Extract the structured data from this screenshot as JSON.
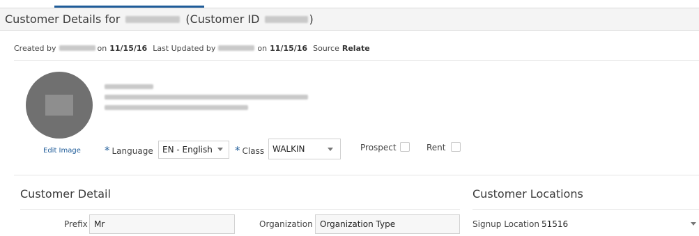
{
  "header": {
    "title_prefix": "Customer Details for",
    "title_customer_id_label": "(Customer ID",
    "title_close_paren": ")"
  },
  "meta": {
    "created_by_label": "Created by",
    "on_label_1": "on",
    "created_date": "11/15/16",
    "last_updated_by_label": "Last Updated by",
    "on_label_2": "on",
    "updated_date": "11/15/16",
    "source_label": "Source",
    "source_value": "Relate"
  },
  "profile": {
    "edit_image_label": "Edit Image",
    "language_label": "Language",
    "language_value": "EN - English",
    "class_label": "Class",
    "class_value": "WALKIN",
    "prospect_label": "Prospect",
    "rent_label": "Rent",
    "required_marker": "*"
  },
  "customer_detail": {
    "section_title": "Customer Detail",
    "prefix_label": "Prefix",
    "prefix_value": "Mr",
    "organization_label": "Organization",
    "organization_type_value": "Organization Type"
  },
  "customer_locations": {
    "section_title": "Customer Locations",
    "signup_location_label": "Signup Location",
    "signup_location_value": "51516"
  },
  "colors": {
    "accent": "#1f5c99",
    "avatar": "#707070",
    "title_bar": "#f4f4f4"
  },
  "icons": {
    "avatar_placeholder": "image-placeholder-icon",
    "dropdown": "chevron-down-icon"
  }
}
